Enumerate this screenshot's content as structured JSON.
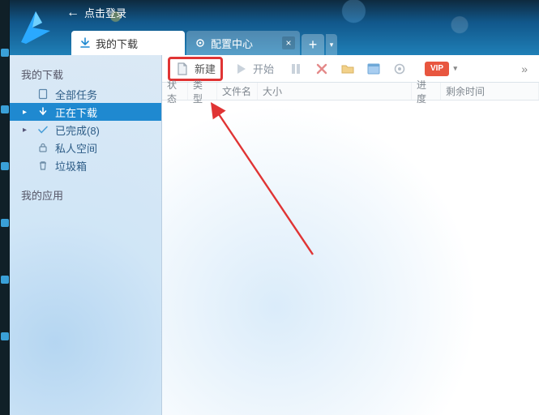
{
  "login": {
    "label": "点击登录"
  },
  "tabs": {
    "active": {
      "label": "我的下载"
    },
    "inactive": {
      "label": "配置中心"
    }
  },
  "sidebar": {
    "section_downloads": "我的下载",
    "items": [
      {
        "label": "全部任务"
      },
      {
        "label": "正在下载"
      },
      {
        "label": "已完成(8)"
      },
      {
        "label": "私人空间"
      },
      {
        "label": "垃圾箱"
      }
    ],
    "section_apps": "我的应用"
  },
  "toolbar": {
    "new_label": "新建",
    "start_label": "开始",
    "vip_label": "VIP"
  },
  "columns": {
    "c0": "状态",
    "c1": "类型",
    "c2": "文件名",
    "c3": "大小",
    "c4": "进度",
    "c5": "剩余时间"
  }
}
